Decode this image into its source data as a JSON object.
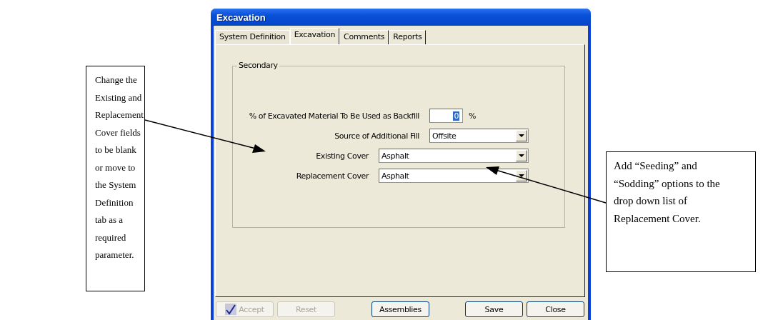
{
  "dialog": {
    "title": "Excavation",
    "tabs": [
      {
        "label": "System Definition",
        "selected": false
      },
      {
        "label": "Excavation",
        "selected": true
      },
      {
        "label": "Comments",
        "selected": false
      },
      {
        "label": "Reports",
        "selected": false
      }
    ],
    "group": {
      "title": "Secondary",
      "fields": [
        {
          "kind": "spin",
          "label": "% of Excavated Material To Be Used as Backfill",
          "value": "0",
          "unit": "%"
        },
        {
          "kind": "dropdown",
          "label": "Source of Additional Fill",
          "value": "Offsite"
        },
        {
          "kind": "wide-dropdown",
          "label": "Existing Cover",
          "value": "Asphalt"
        },
        {
          "kind": "wide-dropdown",
          "label": "Replacement Cover",
          "value": "Asphalt"
        }
      ]
    },
    "buttons": [
      {
        "kind": "checked",
        "label": "Accept",
        "disabled": true
      },
      {
        "kind": "plain",
        "label": "Reset",
        "disabled": true
      },
      {
        "kind": "plain",
        "label": "Assemblies",
        "disabled": false
      },
      {
        "kind": "plain",
        "label": "Save",
        "disabled": false
      },
      {
        "kind": "plain",
        "label": "Close",
        "disabled": false
      }
    ]
  },
  "callouts": [
    {
      "text": "Change the Existing and Replacement Cover fields to be blank or move to the System Definition tab as a required parameter."
    },
    {
      "text": "Add “Seeding” and “Sodding” options to the drop down list of Replacement Cover."
    }
  ]
}
